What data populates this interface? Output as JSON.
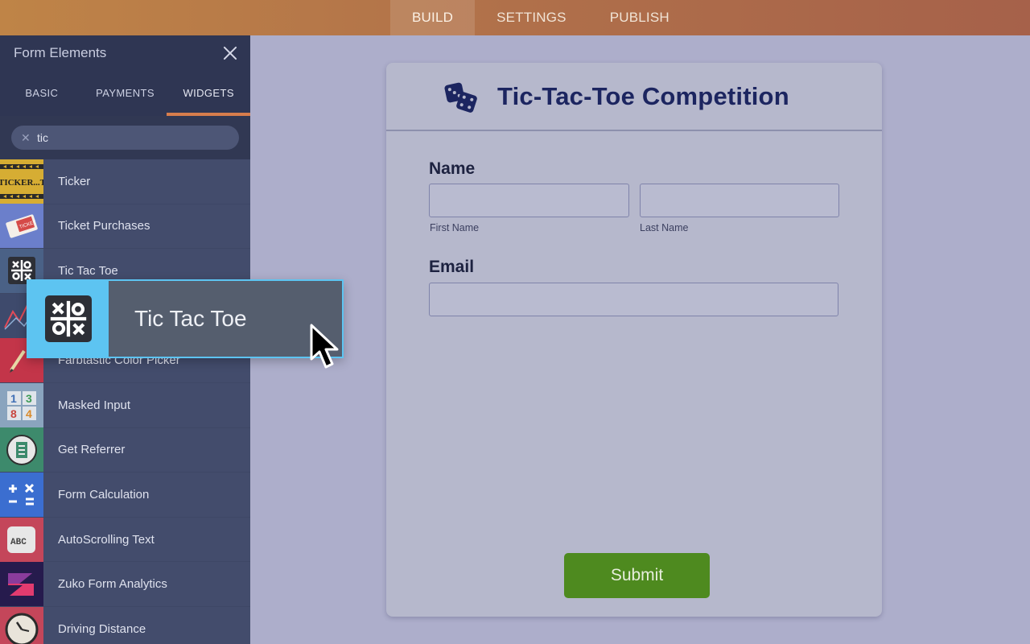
{
  "topbar": {
    "tabs": [
      {
        "label": "BUILD",
        "active": true
      },
      {
        "label": "SETTINGS",
        "active": false
      },
      {
        "label": "PUBLISH",
        "active": false
      }
    ]
  },
  "sidebar": {
    "title": "Form Elements",
    "tabs": [
      {
        "label": "BASIC"
      },
      {
        "label": "PAYMENTS"
      },
      {
        "label": "WIDGETS",
        "active": true
      }
    ],
    "search": {
      "value": "tic",
      "clear_icon": "close-icon"
    },
    "items": [
      {
        "label": "Ticker",
        "icon": "ticker-icon"
      },
      {
        "label": "Ticket Purchases",
        "icon": "ticket-icon"
      },
      {
        "label": "Tic Tac Toe",
        "icon": "tic-tac-toe-icon"
      },
      {
        "label": "",
        "icon": "chart-icon"
      },
      {
        "label": "Farbtastic Color Picker",
        "icon": "pencil-icon"
      },
      {
        "label": "Masked Input",
        "icon": "number-blocks-icon"
      },
      {
        "label": "Get Referrer",
        "icon": "referrer-icon"
      },
      {
        "label": "Form Calculation",
        "icon": "calculator-icon"
      },
      {
        "label": "AutoScrolling Text",
        "icon": "abc-icon"
      },
      {
        "label": "Zuko Form Analytics",
        "icon": "zuko-logo-icon"
      },
      {
        "label": "Driving Distance",
        "icon": "clock-icon"
      }
    ]
  },
  "drag_ghost": {
    "label": "Tic Tac Toe",
    "icon": "tic-tac-toe-icon"
  },
  "form": {
    "title": "Tic-Tac-Toe Competition",
    "title_icon": "dice-icon",
    "name_label": "Name",
    "first_name_sublabel": "First Name",
    "last_name_sublabel": "Last Name",
    "email_label": "Email",
    "submit_label": "Submit"
  },
  "colors": {
    "topbar": "#b0704a",
    "sidebar": "#353c59",
    "accent_tab": "#d77d4c",
    "drag_highlight": "#5dc4f1",
    "submit": "#4e8a1f",
    "form_title": "#1c2560"
  }
}
